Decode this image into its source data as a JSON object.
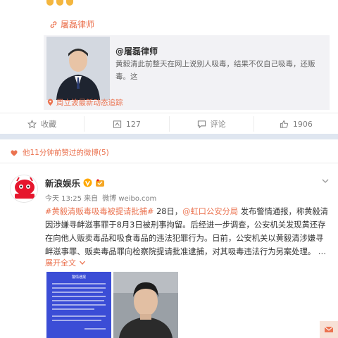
{
  "shared_post": {
    "lawyer_link": "屠磊律师",
    "quote_author": "@屠磊律师",
    "quote_text": "黄毅清此前整天在网上说别人吸毒，结果不仅自己吸毒，还贩毒。这\n是典型的贼喊捉贼。这种情况还有没有？有些人微博疯癫程度跟此人",
    "follow_link": "周立波最新动态追踪"
  },
  "actions": {
    "favorite_label": "收藏",
    "repost_count": "127",
    "comment_label": "评论",
    "like_count": "1906"
  },
  "liked_notice": "他11分钟前赞过的微博(5)",
  "post": {
    "account_name": "新浪娱乐",
    "time": "今天 13:25 来自",
    "source": "微博 weibo.com",
    "text_parts": [
      {
        "text": "#黄毅清贩毒吸毒被提请批捕#",
        "hl": true
      },
      {
        "text": " 28日，",
        "hl": false
      },
      {
        "text": "@虹口公安分局",
        "hl": true
      },
      {
        "text": " 发布警情通报，称黄毅清因涉嫌寻衅滋事罪于8月3日被刑事拘留。后经进一步调查，公安机关发现黄还存在向他人贩卖毒品和吸食毒品的违法犯罪行为。日前，公安机关以黄毅清涉嫌寻衅滋事罪、贩卖毒品罪向检察院提请批准逮捕，对其吸毒违法行为另案处理。 …",
        "hl": false
      }
    ],
    "expand_label": "展开全文",
    "image1_title": "警情通报"
  },
  "colors": {
    "accent": "#eb7350",
    "text": "#333333",
    "muted": "#808080",
    "band": "#dfe6f0",
    "quote_bg": "#f2f2f5"
  }
}
